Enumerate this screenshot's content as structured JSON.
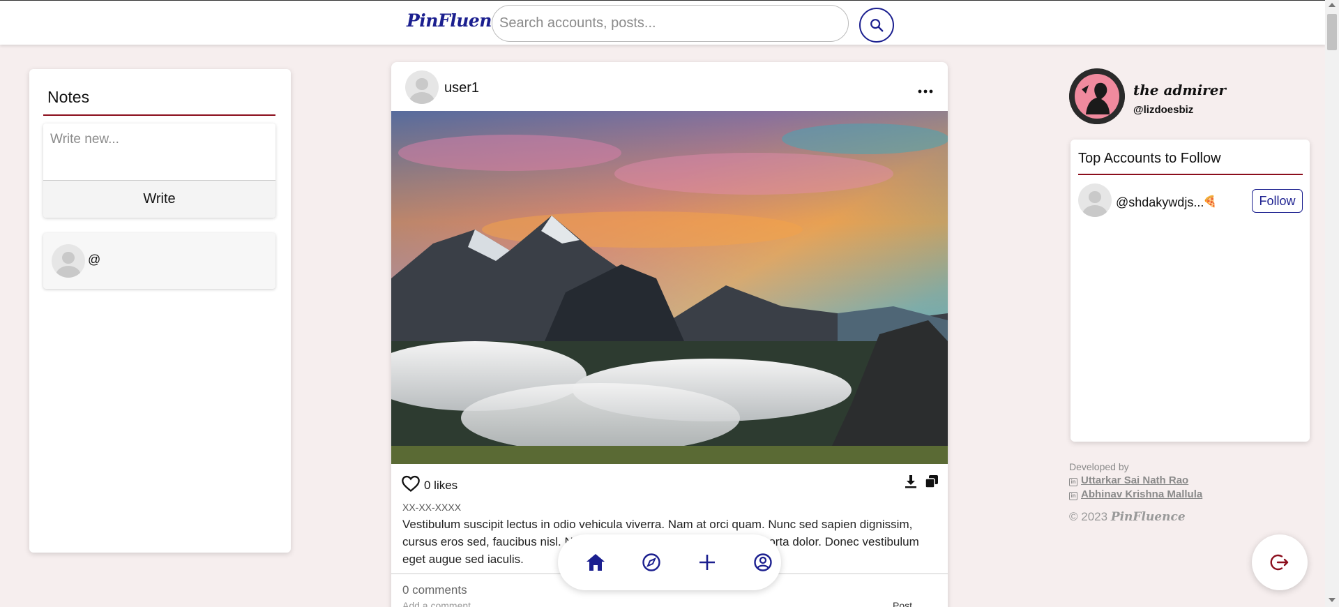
{
  "app": {
    "brand": "PinFluence"
  },
  "colors": {
    "brand": "#1b1f8f",
    "accent": "#8b0d1c",
    "background": "#f6eeee"
  },
  "search": {
    "placeholder": "Search accounts, posts..."
  },
  "notes": {
    "title": "Notes",
    "placeholder": "Write new...",
    "write_label": "Write",
    "items": [
      {
        "text": "@"
      }
    ]
  },
  "post": {
    "username": "user1",
    "likes": "0 likes",
    "date": "XX-XX-XXXX",
    "caption": "Vestibulum suscipit lectus in odio vehicula viverra. Nam at orci quam. Nunc sed sapien dignissim, cursus eros sed, faucibus nisl. Nulla facilisi. Donec quis sagittis orci, porta dolor. Donec vestibulum eget augue sed iaculis.",
    "comments": "0 comments",
    "add_comment_placeholder": "Add a comment...",
    "post_label": "Post"
  },
  "profile": {
    "name": "the admirer",
    "handle": "@lizdoesbiz"
  },
  "top_accounts": {
    "title": "Top Accounts to Follow",
    "items": [
      {
        "handle": "@shdakywdjs...",
        "emoji": "🍕",
        "follow_label": "Follow"
      }
    ]
  },
  "footer": {
    "developed_by": "Developed by",
    "developers": [
      "Uttarkar Sai Nath Rao",
      "Abhinav Krishna Mallula"
    ],
    "copyright": "© 2023",
    "brand": "PinFluence"
  },
  "icons": {
    "search": "search-icon",
    "more": "more-horizontal-icon",
    "like": "heart-icon",
    "download": "download-icon",
    "copy": "copy-icon",
    "home": "home-icon",
    "explore": "compass-icon",
    "create": "plus-icon",
    "profile": "user-circle-icon",
    "logout": "logout-icon",
    "linkedin": "linkedin-icon"
  }
}
